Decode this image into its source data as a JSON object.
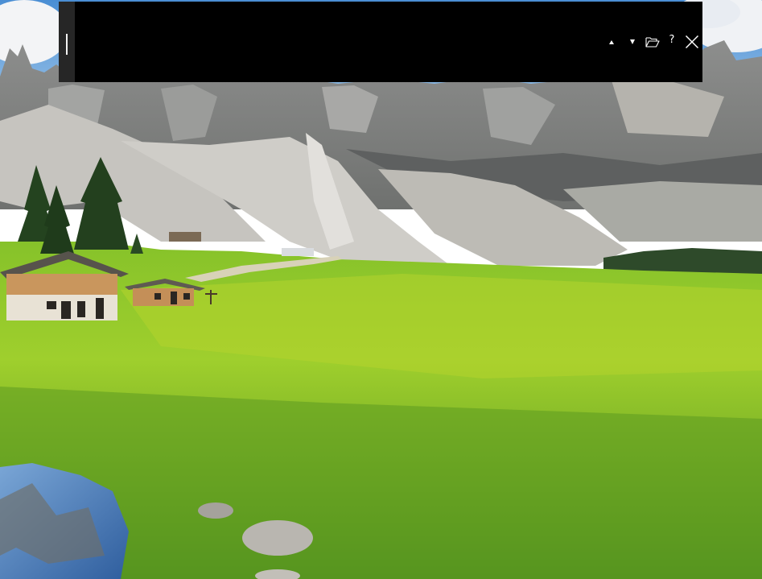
{
  "wallpaper": {
    "description_icon": "landscape-image",
    "colors": {
      "sky": "#5b9fd8",
      "cloud": "#f3f4f6",
      "mountain": "#9a9a98",
      "mountain_dark": "#6b6c6c",
      "scree": "#c9c8c3",
      "meadow": "#8dc428",
      "meadow_light": "#b8d62c",
      "meadow_dark": "#4f8e1d",
      "forest": "#2e4a2a",
      "cabin_wood": "#c9965d",
      "cabin_roof": "#5f5a52",
      "pond": "#4b7fc2"
    }
  },
  "search_bar": {
    "query": "",
    "placeholder": "",
    "background": "#000000",
    "grip_color": "#262626",
    "icons": {
      "previous": "triangle-up-icon",
      "next": "triangle-down-icon",
      "open": "folder-open-icon",
      "help": "question-mark-icon",
      "close": "close-x-icon"
    },
    "help_label": "?"
  }
}
